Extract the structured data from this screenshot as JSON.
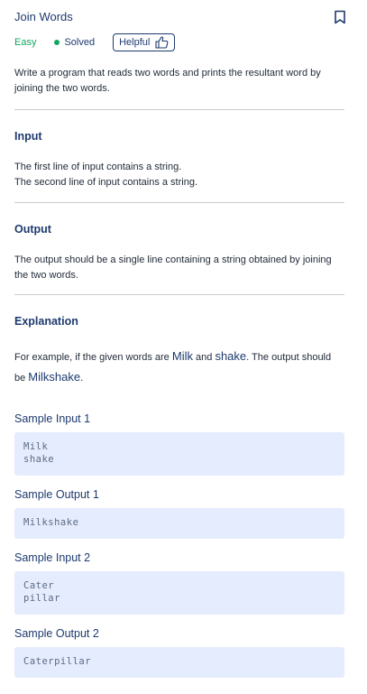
{
  "problem": {
    "title": "Join Words",
    "difficulty": "Easy",
    "status": "Solved",
    "helpful_label": "Helpful"
  },
  "description": "Write a program that reads two words and prints the resultant word by joining the two words.",
  "input_section": {
    "heading": "Input",
    "lines": [
      "The first line of input contains a string.",
      "The second line of input contains a string."
    ]
  },
  "output_section": {
    "heading": "Output",
    "text": "The output should be a single line containing a string obtained by joining the two words."
  },
  "explanation": {
    "heading": "Explanation",
    "parts": [
      "For example, if the given words are ",
      "Milk",
      " and ",
      "shake",
      ". The output should be ",
      "Milkshake",
      "."
    ]
  },
  "samples": [
    {
      "label": "Sample Input 1",
      "content": "Milk\nshake"
    },
    {
      "label": "Sample Output 1",
      "content": "Milkshake"
    },
    {
      "label": "Sample Input 2",
      "content": "Cater\npillar"
    },
    {
      "label": "Sample Output 2",
      "content": "Caterpillar"
    }
  ],
  "colors": {
    "accent": "#1e3a6e",
    "easy": "#10a760",
    "sample_bg": "#e5ecfd"
  },
  "icons": [
    "bookmark-icon",
    "thumbs-up-icon"
  ]
}
